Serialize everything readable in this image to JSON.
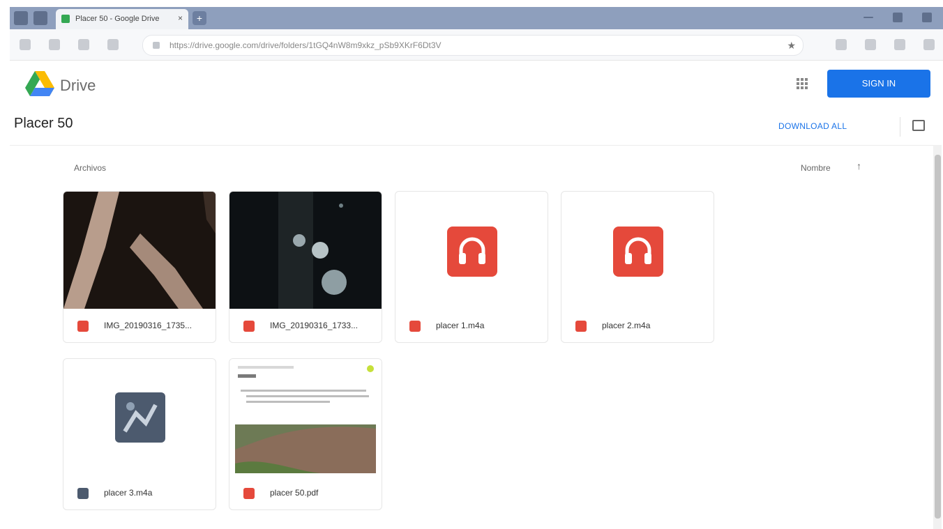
{
  "browser": {
    "tab_title": "Placer 50 - Google Drive",
    "tab_close": "×",
    "new_tab": "+",
    "url": "https://drive.google.com/drive/folders/1tGQ4nW8m9xkz_pSb9XKrF6Dt3V",
    "bookmark_icon": "★"
  },
  "drive": {
    "logo_text": "Drive",
    "sign_in": "SIGN IN",
    "folder_title": "Placer 50",
    "download_all": "DOWNLOAD ALL",
    "section_label": "Archivos",
    "sort_label": "Nombre",
    "sort_arrow": "↑"
  },
  "files": [
    {
      "name": "IMG_20190316_1735...",
      "type_color": "#e5493b",
      "kind": "image-branch"
    },
    {
      "name": "IMG_20190316_1733...",
      "type_color": "#e5493b",
      "kind": "image-dark"
    },
    {
      "name": "placer 1.m4a",
      "type_color": "#e5493b",
      "kind": "audio"
    },
    {
      "name": "placer 2.m4a",
      "type_color": "#e5493b",
      "kind": "audio"
    },
    {
      "name": "placer 3.m4a",
      "type_color": "#4c5a6e",
      "kind": "video"
    },
    {
      "name": "placer 50.pdf",
      "type_color": "#e5493b",
      "kind": "pdf"
    }
  ],
  "colors": {
    "accent": "#1a73e8",
    "tabstrip": "#8e9fbd",
    "audio_red": "#e5493b"
  }
}
